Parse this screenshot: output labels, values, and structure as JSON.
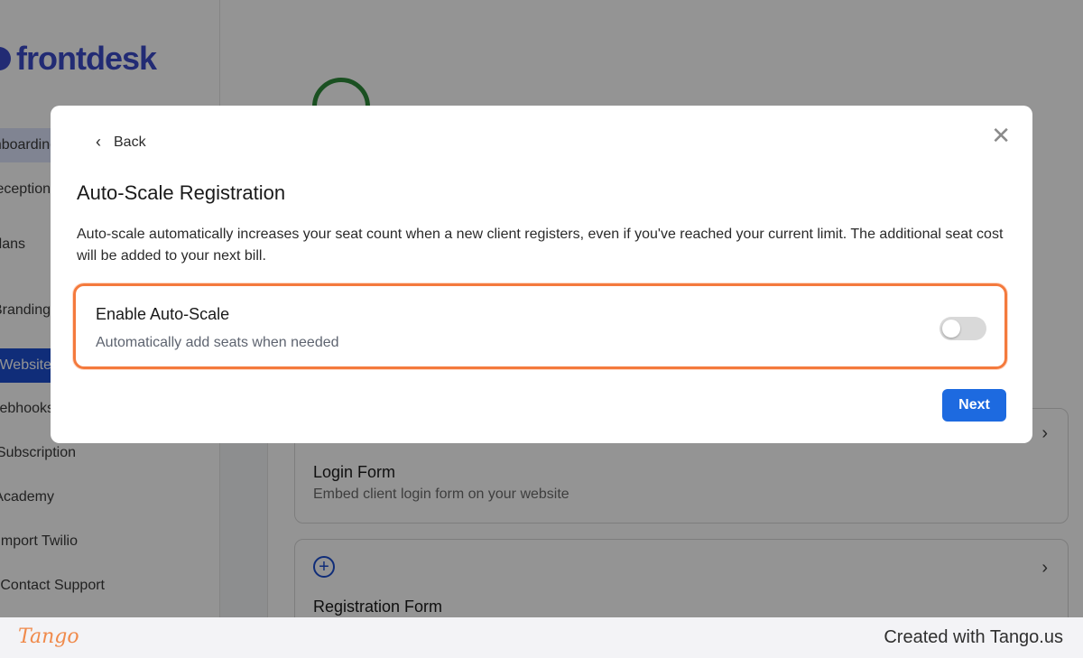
{
  "sidebar": {
    "brand": {
      "part1": "front",
      "part2": "desk"
    },
    "items": [
      {
        "label": "Onboarding",
        "state": "light"
      },
      {
        "label": "My Receptionist",
        "state": "none"
      },
      {
        "label": "Plans",
        "state": "none"
      },
      {
        "label": "Branding",
        "state": "none"
      },
      {
        "label": "Website",
        "state": "dark"
      },
      {
        "label": "Webhooks",
        "state": "none"
      },
      {
        "label": "Subscription",
        "state": "none"
      },
      {
        "label": "Academy",
        "state": "none"
      },
      {
        "label": "Import Twilio",
        "state": "none"
      },
      {
        "label": "Contact Support",
        "state": "none"
      }
    ]
  },
  "cards": [
    {
      "title": "Login Form",
      "subtitle": "Embed client login form on your website"
    },
    {
      "title": "Registration Form",
      "subtitle": ""
    }
  ],
  "modal": {
    "back_label": "Back",
    "close_icon": "close-icon",
    "title": "Auto-Scale Registration",
    "description": "Auto-scale automatically increases your seat count when a new client registers, even if you've reached your current limit. The additional seat cost will be added to your next bill.",
    "toggle": {
      "title": "Enable Auto-Scale",
      "subtitle": "Automatically add seats when needed",
      "enabled": false
    },
    "next_label": "Next"
  },
  "footer": {
    "logo_text": "Tango",
    "credit": "Created with Tango.us"
  },
  "colors": {
    "accent": "#1d6ae0",
    "highlight": "#f47a3d",
    "tango": "#f08a4b"
  }
}
